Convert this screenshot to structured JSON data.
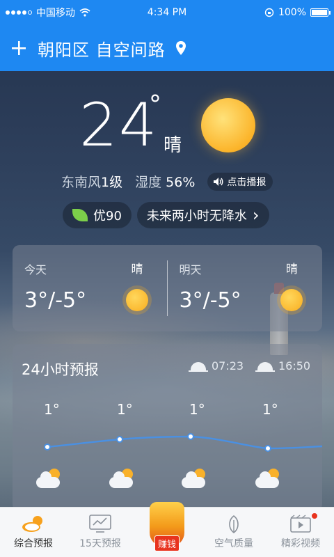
{
  "status_bar": {
    "carrier": "中国移动",
    "time": "4:34 PM",
    "battery": "100%"
  },
  "header": {
    "add_icon": "plus-icon",
    "location": "朝阳区 自空间路",
    "location_icon": "pin-icon"
  },
  "current": {
    "temperature": "24",
    "degree_symbol": "°",
    "condition": "晴",
    "wind_label": "东南风",
    "wind_value": "1级",
    "humidity_label": "湿度",
    "humidity_value": "56%",
    "broadcast_label": "点击播报"
  },
  "chips": {
    "aqi": "优90",
    "rain_notice": "未来两小时无降水",
    "rain_arrow": "›"
  },
  "days": [
    {
      "label": "今天",
      "condition": "晴",
      "range": "3°/-5°"
    },
    {
      "label": "明天",
      "condition": "晴",
      "range": "3°/-5°"
    }
  ],
  "forecast_24h": {
    "title": "24小时预报",
    "sunrise": "07:23",
    "sunset": "16:50",
    "hours": [
      {
        "temp": "1°",
        "value": 1
      },
      {
        "temp": "1°",
        "value": 1
      },
      {
        "temp": "1°",
        "value": 1
      },
      {
        "temp": "1°",
        "value": 1
      }
    ]
  },
  "tabs": [
    {
      "label": "综合预报",
      "icon": "cloud-sun-icon",
      "active": true
    },
    {
      "label": "15天预报",
      "icon": "chart-screen-icon",
      "active": false
    },
    {
      "label": "赚钱",
      "icon": "money-bag-icon",
      "active": false
    },
    {
      "label": "空气质量",
      "icon": "leaf-icon",
      "active": false
    },
    {
      "label": "精彩视频",
      "icon": "video-icon",
      "active": false
    }
  ],
  "colors": {
    "header_blue": "#1e88f2",
    "line_blue": "#4a90e2",
    "sun_orange": "#f9ad1f"
  }
}
